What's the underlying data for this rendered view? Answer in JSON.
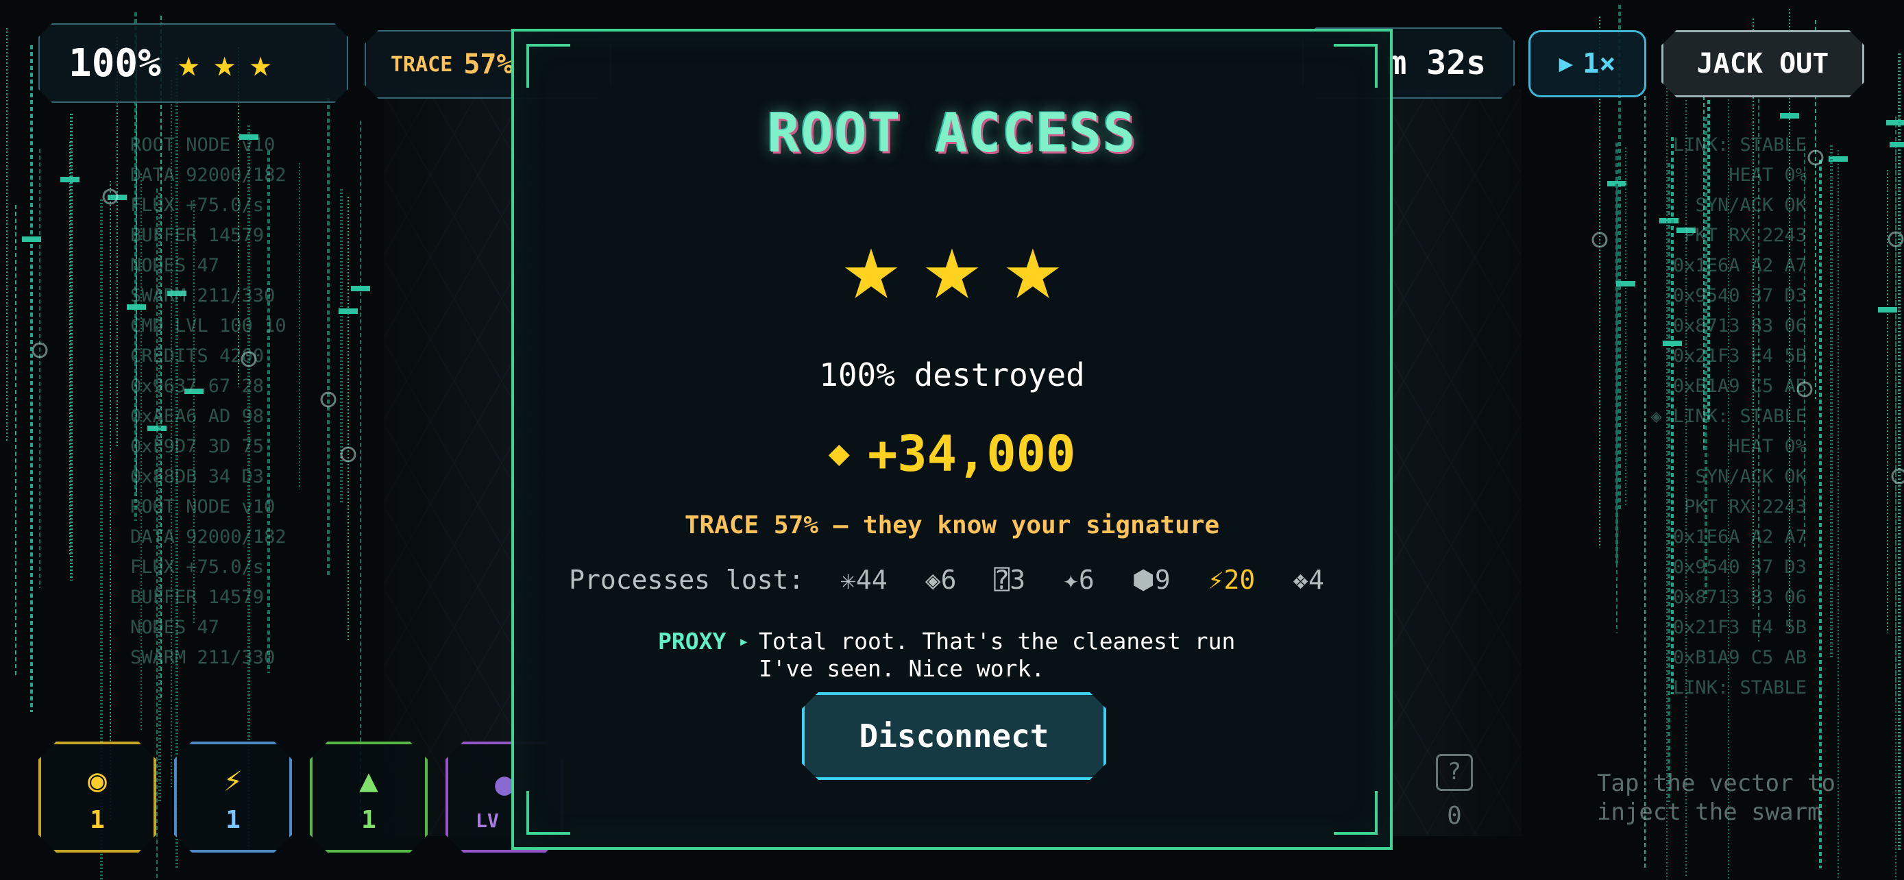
{
  "hud": {
    "score_pct": "100%",
    "stars": [
      "★",
      "★",
      "★"
    ],
    "trace_label": "TRACE",
    "trace_value": "57%",
    "timer": "m 32s",
    "speed_label": "1×",
    "jack_out_label": "JACK OUT"
  },
  "left_terminal": [
    "ROOT NODE v10",
    "DATA 92000/182",
    "FLUX +75.0/s",
    "BUFFER 14579",
    "NODES 47",
    "SWARM 211/330",
    "CMD LVL 100 10",
    "CREDITS 4200",
    "0x9637 67 28",
    "0xAEA6 AD 98",
    "0xF9D7 3D 75",
    "0x88DB 34 D3",
    "ROOT NODE v10",
    "DATA 92000/182",
    "FLUX +75.0/s",
    "BUFFER 14579",
    "NODES 47",
    "SWARM 211/330"
  ],
  "right_terminal": [
    "LINK: STABLE",
    "HEAT 0%",
    "SYN/ACK OK",
    "PKT RX 2243",
    "0x1E6A A2 A7",
    "0x9540 37 D3",
    "0x8713 83 06",
    "0x21F3 E4 5B",
    "0xB1A9 C5 AB",
    "◈ LINK: STABLE",
    "HEAT 0%",
    "SYN/ACK OK",
    "PKT RX 2243",
    "0x1E6A A2 A7",
    "0x9540 37 D3",
    "0x8713 83 06",
    "0x21F3 E4 5B",
    "0xB1A9 C5 AB",
    "LINK: STABLE"
  ],
  "hint": "Tap the vector to inject the swarm",
  "units": [
    {
      "icon": "◉",
      "count": "1"
    },
    {
      "icon": "⚡",
      "count": "1"
    },
    {
      "icon": "▲",
      "count": "1"
    },
    {
      "lv_label": "LV"
    }
  ],
  "unknown_slot": {
    "icon": "?",
    "count": "0"
  },
  "modal": {
    "title": "ROOT ACCESS",
    "stars": [
      "★",
      "★",
      "★"
    ],
    "destroyed_text": "100% destroyed",
    "reward_icon": "◆",
    "reward_text": "+34,000",
    "trace_line": "TRACE 57% — they know your signature",
    "lost_label": "Processes lost:",
    "lost_items": [
      "✳44",
      "◈6",
      "⍰3",
      "✦6",
      "⬢9",
      "⚡20",
      "❖4"
    ],
    "speaker": "PROXY",
    "speaker_arrow": "▸",
    "message": "Total root. That's the cleanest run I've seen. Nice work.",
    "button_label": "Disconnect"
  },
  "colors": {
    "accent_green": "#3fd492",
    "gold": "#ffd21f",
    "trace_orange": "#ffc35a",
    "button_cyan": "#3fd2f0"
  }
}
